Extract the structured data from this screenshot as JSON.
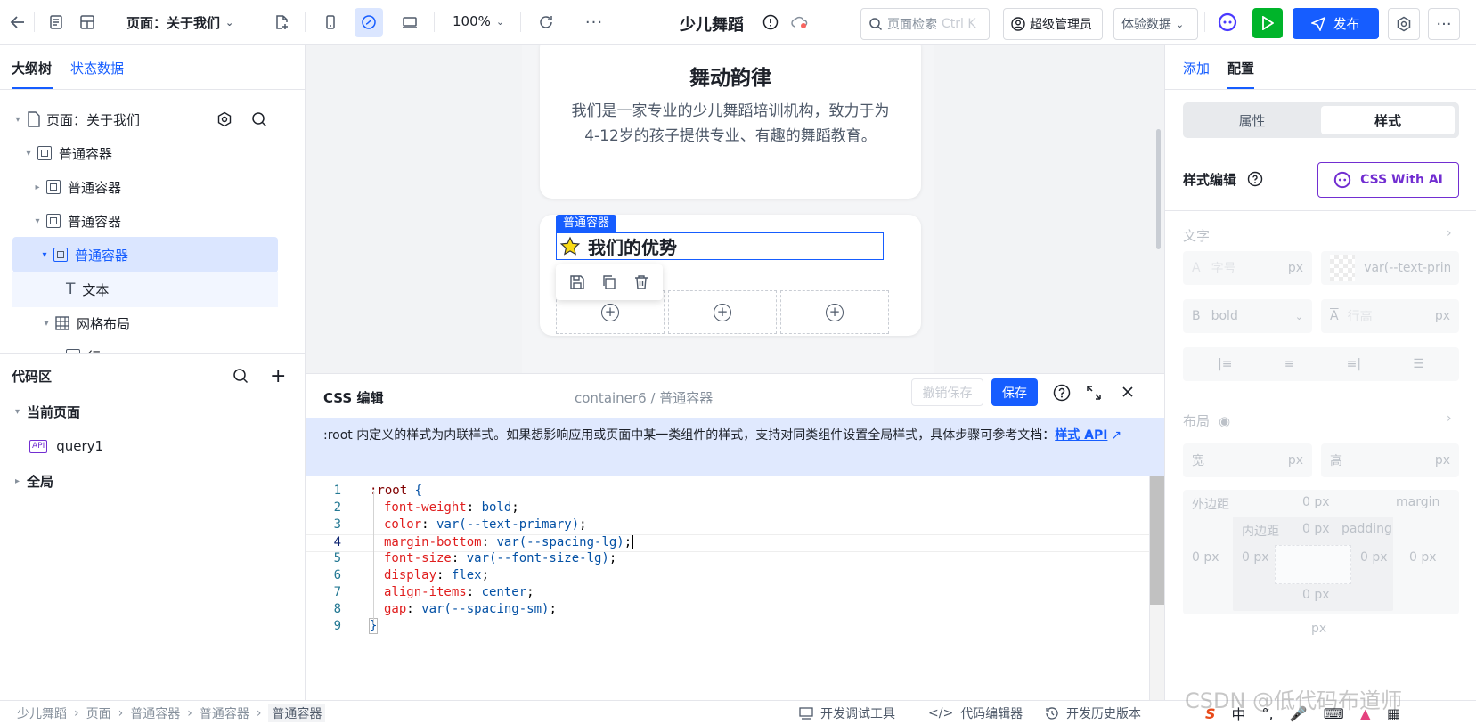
{
  "topbar": {
    "page_selector": "页面：关于我们",
    "zoom": "100%",
    "app_title": "少儿舞蹈",
    "search_placeholder": "页面检索",
    "search_shortcut": "Ctrl K",
    "user": "超级管理员",
    "data_mode": "体验数据",
    "publish": "发布"
  },
  "left": {
    "tabs": [
      "大纲树",
      "状态数据"
    ],
    "tree": [
      {
        "label": "页面：关于我们"
      },
      {
        "label": "普通容器"
      },
      {
        "label": "普通容器"
      },
      {
        "label": "普通容器"
      },
      {
        "label": "普通容器"
      },
      {
        "label": "文本"
      },
      {
        "label": "网格布局"
      },
      {
        "label": "行"
      }
    ],
    "code_title": "代码区",
    "code_tree": [
      "当前页面",
      "query1",
      "全局"
    ],
    "api_badge": "API"
  },
  "canvas": {
    "card_title": "舞动韵律",
    "card_desc": "我们是一家专业的少儿舞蹈培训机构，致力于为4-12岁的孩子提供专业、有趣的舞蹈教育。",
    "container_badge": "普通容器",
    "selected_text": "我们的优势"
  },
  "editor": {
    "title": "CSS 编辑",
    "path": "container6 / 普通容器",
    "revert": "撤销保存",
    "save": "保存",
    "notice": ":root 内定义的样式为内联样式。如果想影响应用或页面中某一类组件的样式，支持对同类组件设置全局样式，具体步骤可参考文档：",
    "notice_link": "样式 API",
    "lines": [
      {
        "n": "1",
        "sel": ":root",
        "brace": " {"
      },
      {
        "n": "2",
        "prop": "font-weight",
        "val": "bold"
      },
      {
        "n": "3",
        "prop": "color",
        "val": "var(--text-primary)"
      },
      {
        "n": "4",
        "prop": "margin-bottom",
        "val": "var(--spacing-lg)"
      },
      {
        "n": "5",
        "prop": "font-size",
        "val": "var(--font-size-lg)"
      },
      {
        "n": "6",
        "prop": "display",
        "val": "flex"
      },
      {
        "n": "7",
        "prop": "align-items",
        "val": "center"
      },
      {
        "n": "8",
        "prop": "gap",
        "val": "var(--spacing-sm)"
      },
      {
        "n": "9",
        "close": "}"
      }
    ]
  },
  "right": {
    "tabs": [
      "添加",
      "配置"
    ],
    "seg": [
      "属性",
      "样式"
    ],
    "style_edit": "样式编辑",
    "ai_button": "CSS With AI",
    "section_text": "文字",
    "font_size_placeholder": "字号",
    "unit_px": "px",
    "color_value": "var(--text-prim",
    "weight_prefix": "B",
    "weight_value": "bold",
    "line_height": "行高",
    "section_layout": "布局",
    "width": "宽",
    "height": "高",
    "margin_label": "外边距",
    "margin_en": "margin",
    "padding_label": "内边距",
    "padding_en": "padding",
    "zero_px": "0 px",
    "px": "px",
    "font_a": "A",
    "font_a2": "A"
  },
  "bottom": {
    "breadcrumb": [
      "少儿舞蹈",
      "页面",
      "普通容器",
      "普通容器",
      "普通容器"
    ],
    "tools": [
      "开发调试工具",
      "代码编辑器",
      "开发历史版本"
    ],
    "watermark": "CSDN @低代码布道师",
    "ime": "中"
  },
  "colors": {
    "primary": "#165dff",
    "run_green": "#00b42a",
    "ai_purple": "#722ed1",
    "selected_bg": "#dbe6ff"
  }
}
